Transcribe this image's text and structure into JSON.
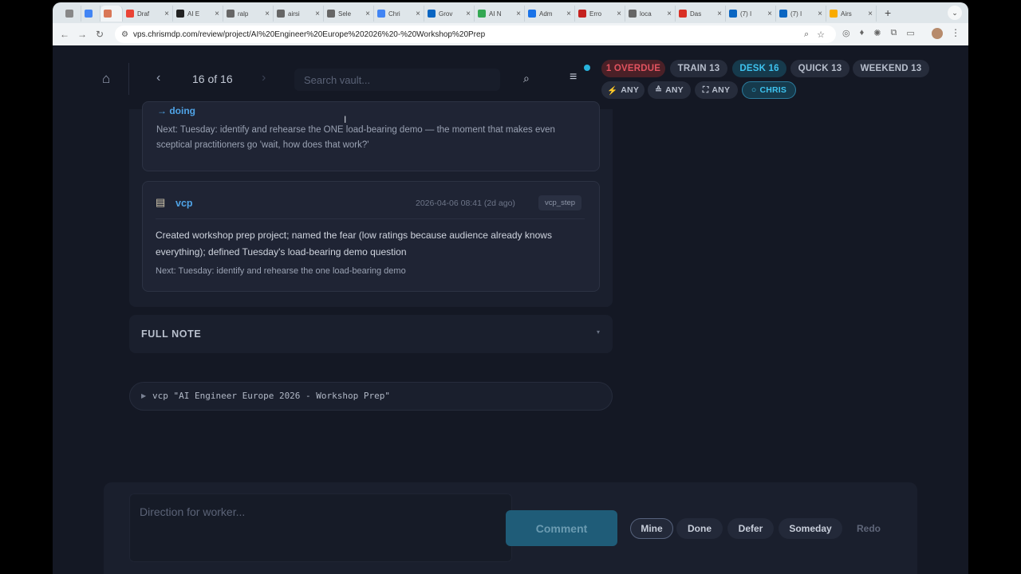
{
  "browser": {
    "tabs": [
      {
        "title": "",
        "icon": "generic-icon",
        "color": "#888888"
      },
      {
        "title": "",
        "icon": "google-icon",
        "color": "#4285f4"
      },
      {
        "title": "",
        "icon": "active-tab-icon",
        "color": "#d97757"
      },
      {
        "title": "Draf",
        "icon": "gmail-icon",
        "color": "#ea4335"
      },
      {
        "title": "AI E",
        "icon": "ai-icon",
        "color": "#222222"
      },
      {
        "title": "ralp",
        "icon": "globe-icon",
        "color": "#666666"
      },
      {
        "title": "airsi",
        "icon": "globe-icon",
        "color": "#666666"
      },
      {
        "title": "Sele",
        "icon": "globe-icon",
        "color": "#666666"
      },
      {
        "title": "Chri",
        "icon": "doc-icon",
        "color": "#4285f4"
      },
      {
        "title": "Grov",
        "icon": "linkedin-icon",
        "color": "#0a66c2"
      },
      {
        "title": "AI N",
        "icon": "green-icon",
        "color": "#34a853"
      },
      {
        "title": "Adm",
        "icon": "blue-icon",
        "color": "#1a73e8"
      },
      {
        "title": "Erro",
        "icon": "red-icon",
        "color": "#c5221f"
      },
      {
        "title": "loca",
        "icon": "globe-icon",
        "color": "#666666"
      },
      {
        "title": "Das",
        "icon": "red-square-icon",
        "color": "#d93025"
      },
      {
        "title": "(7) I",
        "icon": "linkedin-icon",
        "color": "#0a66c2"
      },
      {
        "title": "(7) I",
        "icon": "linkedin-icon",
        "color": "#0a66c2"
      },
      {
        "title": "Airs",
        "icon": "yellow-icon",
        "color": "#f9ab00"
      }
    ],
    "url": "vps.chrismdp.com/review/project/AI%20Engineer%20Europe%202026%20-%20Workshop%20Prep"
  },
  "header": {
    "counter": "16 of 16",
    "search_placeholder": "Search vault...",
    "pills": {
      "overdue": "1 OVERDUE",
      "train": "TRAIN 13",
      "desk": "DESK 16",
      "quick": "QUICK 13",
      "weekend": "WEEKEND 13"
    },
    "filters": {
      "any1": "ANY",
      "any2": "ANY",
      "any3": "ANY",
      "chris": "CHRIS"
    }
  },
  "entries": {
    "doing_label": "→ doing",
    "doing_next": "Next: Tuesday: identify and rehearse the ONE load-bearing demo — the moment that makes even sceptical practitioners go 'wait, how does that work?'",
    "vcp_title": "vcp",
    "vcp_date": "2026-04-06 08:41 (2d ago)",
    "vcp_tag": "vcp_step",
    "vcp_body": "Created workshop prep project; named the fear (low ratings because audience already knows everything); defined Tuesday's load-bearing demo question",
    "vcp_next": "Next: Tuesday: identify and rehearse the one load-bearing demo"
  },
  "full_note": {
    "label": "FULL NOTE",
    "chevron": "▾"
  },
  "vcp_command": {
    "arrow": "▶",
    "text": "vcp \"AI Engineer Europe 2026 - Workshop Prep\""
  },
  "bottom": {
    "direction_placeholder": "Direction for worker...",
    "comment": "Comment",
    "actions": {
      "mine": "Mine",
      "done": "Done",
      "defer": "Defer",
      "someday": "Someday",
      "redo": "Redo"
    }
  }
}
